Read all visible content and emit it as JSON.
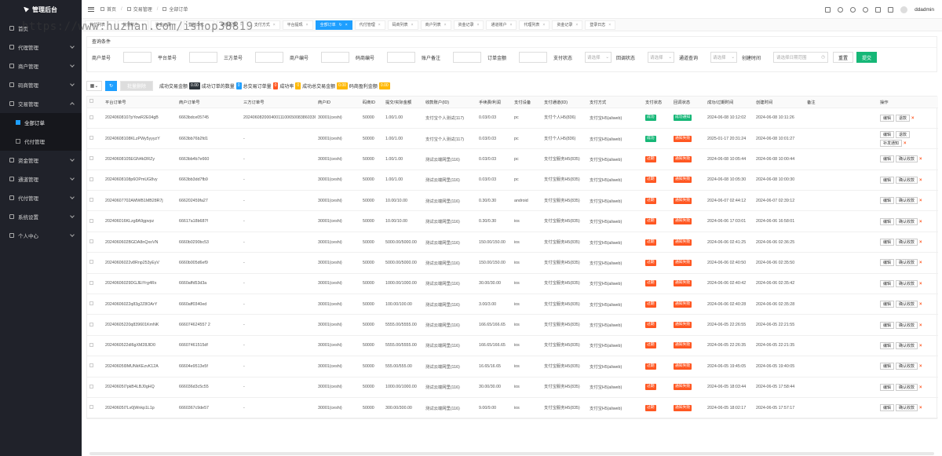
{
  "app": {
    "title": "管理后台",
    "user": "ddadmin"
  },
  "watermark": "https://www.huzhan.com/ishop38819",
  "sidebar": {
    "items": [
      {
        "label": "首页"
      },
      {
        "label": "代理管理"
      },
      {
        "label": "商户管理"
      },
      {
        "label": "码商管理"
      },
      {
        "label": "交易管理"
      },
      {
        "label": "资金管理"
      },
      {
        "label": "通道管理"
      },
      {
        "label": "代付管理"
      },
      {
        "label": "系统设置"
      },
      {
        "label": "个人中心"
      }
    ],
    "sub": [
      {
        "label": "全部订单"
      },
      {
        "label": "代付管理"
      }
    ]
  },
  "breadcrumb": [
    "首页",
    "交易管理",
    "全部订单"
  ],
  "tabs": [
    "代付列表",
    "代付账户",
    "资金记录",
    "登陆日志",
    "通道配置",
    "支付方式",
    "平台提现",
    "全部订单",
    "代付管理",
    "码商列表",
    "商户列表",
    "资金记录",
    "通道账户",
    "代理列表",
    "资金记录",
    "登录日志"
  ],
  "filter": {
    "title": "查询条件",
    "labels": [
      "商户单号",
      "平台单号",
      "三方单号",
      "商户编号",
      "码商编号",
      "账户备注",
      "订单金额",
      "支付状态",
      "回调状态",
      "通道查询",
      "创建时间"
    ],
    "select_placeholder": "请选择",
    "date_placeholder": "请选择日期范围",
    "reset": "重置",
    "submit": "提交"
  },
  "toolbar": {
    "batch_delete": "批量删除",
    "stats": [
      {
        "label": "成功交易金额",
        "value": "0.00",
        "color": "black"
      },
      {
        "label": "成功订单的数量",
        "value": "0",
        "color": "blue"
      },
      {
        "label": "总交易订单量",
        "value": "0",
        "color": "red"
      },
      {
        "label": "成功率",
        "value": "0",
        "color": "yellow"
      },
      {
        "label": "成功总交易金额",
        "value": "0.00",
        "color": "yellow"
      },
      {
        "label": "码商盈利金额",
        "value": "0.00",
        "color": "yellow"
      }
    ]
  },
  "table": {
    "columns": [
      "平台订单号",
      "商户订单号",
      "三方订单号",
      "商户ID",
      "码商ID",
      "提交/实际金额",
      "收款账户(ID)",
      "手续费/利润",
      "支付设备",
      "支付通道(ID)",
      "支付方式",
      "支付状态",
      "回调状态",
      "成功/过期时间",
      "创建时间",
      "备注",
      "操作"
    ],
    "rows": [
      {
        "platform": "20240608107pYowR2E04gB",
        "merchant": "6663bdce05745",
        "third": "20240608200040011100650083860336",
        "mid": "30001(ceshi)",
        "code": "50000",
        "amount": "1.00/1.00",
        "account": "支付宝个人测试(117)",
        "fee": "0.03/0.03",
        "device": "pc",
        "channel": "支付个人H5(836)",
        "method": "支付宝H5(aliweb)",
        "pay": "成功",
        "callback": "成功通知",
        "time1": "2024-06-08 10:12:02",
        "time2": "2024-06-08 10:11:26",
        "ops": [
          "编辑",
          "退款"
        ]
      },
      {
        "platform": "20240608108KLzPWy5yyyzY",
        "merchant": "6663bb76b2fd1",
        "third": "-",
        "mid": "30001(ceshi)",
        "code": "50000",
        "amount": "1.00/1.00",
        "account": "支付宝个人测试(117)",
        "fee": "0.03/0.03",
        "device": "pc",
        "channel": "支付个人H5(836)",
        "method": "支付宝H5(aliweb)",
        "pay": "成功",
        "callback": "通知失败",
        "time1": "2025-01-17 20:31:24",
        "time2": "2024-06-08 10:01:27",
        "ops": [
          "编辑",
          "退款",
          "补发通知"
        ]
      },
      {
        "platform": "20240608105EGN4kDRZy",
        "merchant": "6663bb4b7e660",
        "third": "-",
        "mid": "30001(ceshi)",
        "code": "50000",
        "amount": "1.00/1.00",
        "account": "测试云端网里(116)",
        "fee": "0.03/0.03",
        "device": "pc",
        "channel": "支付宝服务H5(835)",
        "method": "支付宝H5(aliweb)",
        "pay": "过期",
        "callback": "通知失败",
        "time1": "2024-06-08 10:05:44",
        "time2": "2024-06-08 10:00:44",
        "ops": [
          "编辑",
          "确认收款"
        ]
      },
      {
        "platform": "20240608108p6OPmUG8vy",
        "merchant": "6663bb3dd7fb9",
        "third": "-",
        "mid": "30001(ceshi)",
        "code": "50000",
        "amount": "1.00/1.00",
        "account": "测试云端网里(116)",
        "fee": "0.03/0.03",
        "device": "pc",
        "channel": "支付宝服务H5(835)",
        "method": "支付宝H5(aliweb)",
        "pay": "过期",
        "callback": "通知失败",
        "time1": "2024-06-08 10:05:30",
        "time2": "2024-06-08 10:00:30",
        "ops": [
          "编辑",
          "确认收款"
        ]
      },
      {
        "platform": "20240607702AMWB1MB28R7j",
        "merchant": "666202459fa27",
        "third": "-",
        "mid": "30001(ceshi)",
        "code": "50000",
        "amount": "10.00/10.00",
        "account": "测试云端网里(116)",
        "fee": "0.30/0.30",
        "device": "android",
        "channel": "支付宝服务H5(835)",
        "method": "支付宝H5(aliweb)",
        "pay": "过期",
        "callback": "通知失败",
        "time1": "2024-06-07 02:44:12",
        "time2": "2024-06-07 02:39:12",
        "ops": [
          "编辑",
          "确认收款"
        ]
      },
      {
        "platform": "202406016KLzg8A9gpvpz",
        "merchant": "66617a18b687f",
        "third": "-",
        "mid": "30001(ceshi)",
        "code": "50000",
        "amount": "10.00/10.00",
        "account": "测试云端网里(116)",
        "fee": "0.30/0.30",
        "device": "ios",
        "channel": "支付宝服务H5(835)",
        "method": "支付宝H5(aliweb)",
        "pay": "过期",
        "callback": "通知失败",
        "time1": "2024-06-06 17:03:01",
        "time2": "2024-06-06 16:58:01",
        "ops": [
          "编辑",
          "确认收款"
        ]
      },
      {
        "platform": "2024060602BGDA8nQxoVN",
        "merchant": "6660b0290bc53",
        "third": "-",
        "mid": "30001(ceshi)",
        "code": "50000",
        "amount": "5000.00/5000.00",
        "account": "测试云端网里(116)",
        "fee": "150.00/150.00",
        "device": "ios",
        "channel": "支付宝服务H5(835)",
        "method": "支付宝H5(aliweb)",
        "pay": "过期",
        "callback": "通知失败",
        "time1": "2024-06-06 02:41:25",
        "time2": "2024-06-06 02:36:25",
        "ops": [
          "编辑",
          "确认收款"
        ]
      },
      {
        "platform": "20240606022v8Rnp253yEyV",
        "merchant": "6660b005d6ef9",
        "third": "-",
        "mid": "30001(ceshi)",
        "code": "50000",
        "amount": "5000.00/5000.00",
        "account": "测试云端网里(116)",
        "fee": "150.00/150.00",
        "device": "ios",
        "channel": "支付宝服务H5(835)",
        "method": "支付宝H5(aliweb)",
        "pay": "过期",
        "callback": "通知失败",
        "time1": "2024-06-06 02:40:50",
        "time2": "2024-06-06 02:35:50",
        "ops": [
          "编辑",
          "确认收款"
        ]
      },
      {
        "platform": "20240606029DGJEiYrg4Rx",
        "merchant": "6660affd53d3a",
        "third": "-",
        "mid": "30001(ceshi)",
        "code": "50000",
        "amount": "1000.00/1000.00",
        "account": "测试云端网里(116)",
        "fee": "30.00/30.00",
        "device": "ios",
        "channel": "支付宝服务H5(835)",
        "method": "支付宝H5(aliweb)",
        "pay": "过期",
        "callback": "通知失败",
        "time1": "2024-06-06 02:40:42",
        "time2": "2024-06-06 02:35:42",
        "ops": [
          "编辑",
          "确认收款"
        ]
      },
      {
        "platform": "20240606022q83g2Z8OArY",
        "merchant": "6660aff0340ed",
        "third": "-",
        "mid": "30001(ceshi)",
        "code": "50000",
        "amount": "100.00/100.00",
        "account": "测试云端网里(116)",
        "fee": "3.00/3.00",
        "device": "ios",
        "channel": "支付宝服务H5(835)",
        "method": "支付宝H5(aliweb)",
        "pay": "过期",
        "callback": "通知失败",
        "time1": "2024-06-06 02:40:28",
        "time2": "2024-06-06 02:35:28",
        "ops": [
          "编辑",
          "确认收款"
        ]
      },
      {
        "platform": "20240605220q839601KmNK",
        "merchant": "666074624557 2",
        "third": "-",
        "mid": "30001(ceshi)",
        "code": "50000",
        "amount": "5555.00/5555.00",
        "account": "测试云端网里(116)",
        "fee": "166.65/166.65",
        "device": "ios",
        "channel": "支付宝服务H5(835)",
        "method": "支付宝H5(aliweb)",
        "pay": "过期",
        "callback": "通知失败",
        "time1": "2024-06-05 22:26:55",
        "time2": "2024-06-05 22:21:55",
        "ops": [
          "编辑",
          "确认收款"
        ]
      },
      {
        "platform": "2024060522dl6gXM28JlD0",
        "merchant": "66607461515df",
        "third": "-",
        "mid": "30001(ceshi)",
        "code": "50000",
        "amount": "5555.00/5555.00",
        "account": "测试云端网里(116)",
        "fee": "166.65/166.65",
        "device": "ios",
        "channel": "支付宝服务H5(835)",
        "method": "支付宝H5(aliweb)",
        "pay": "过期",
        "callback": "通知失败",
        "time1": "2024-06-05 22:26:35",
        "time2": "2024-06-05 22:21:35",
        "ops": [
          "编辑",
          "确认收款"
        ]
      },
      {
        "platform": "20240605l9MUNkKEzvK12A",
        "merchant": "66604e9513e5f",
        "third": "-",
        "mid": "30001(ceshi)",
        "code": "50000",
        "amount": "555.00/555.00",
        "account": "测试云端网里(116)",
        "fee": "16.65/16.65",
        "device": "ios",
        "channel": "支付宝服务H5(835)",
        "method": "支付宝H5(aliweb)",
        "pay": "过期",
        "callback": "通知失败",
        "time1": "2024-06-05 19:45:05",
        "time2": "2024-06-05 19:40:05",
        "ops": [
          "编辑",
          "确认收款"
        ]
      },
      {
        "platform": "20240605l7pkB4LBJ0gHQ",
        "merchant": "666036d3c5c55",
        "third": "-",
        "mid": "30001(ceshi)",
        "code": "50000",
        "amount": "1000.00/1000.00",
        "account": "测试云端网里(116)",
        "fee": "30.00/30.00",
        "device": "ios",
        "channel": "支付宝服务H5(835)",
        "method": "支付宝H5(aliweb)",
        "pay": "过期",
        "callback": "通知失败",
        "time1": "2024-06-05 18:03:44",
        "time2": "2024-06-05 17:58:44",
        "ops": [
          "编辑",
          "确认收款"
        ]
      },
      {
        "platform": "20240605l7Lv0jWnkp1L1p",
        "merchant": "6660367c9de57",
        "third": "-",
        "mid": "30001(ceshi)",
        "code": "50000",
        "amount": "300.00/300.00",
        "account": "测试云端网里(116)",
        "fee": "9.00/9.00",
        "device": "ios",
        "channel": "支付宝服务H5(835)",
        "method": "支付宝H5(aliweb)",
        "pay": "过期",
        "callback": "通知失败",
        "time1": "2024-06-05 18:02:17",
        "time2": "2024-06-05 17:57:17",
        "ops": [
          "编辑",
          "确认收款"
        ]
      }
    ]
  }
}
